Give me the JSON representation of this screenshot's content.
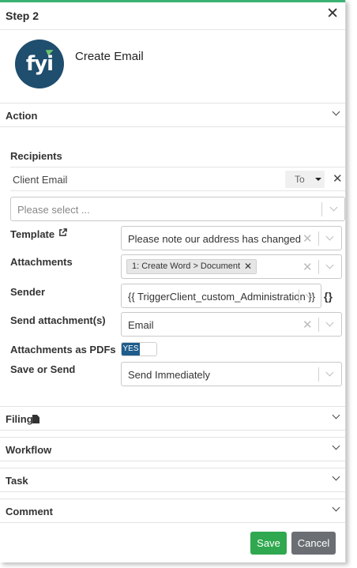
{
  "header": {
    "title": "Step 2",
    "close_icon": "close-icon"
  },
  "step": {
    "name": "Create Email",
    "logo_text": "fyi"
  },
  "sections": {
    "action": "Action",
    "filing": "Filing",
    "workflow": "Workflow",
    "task": "Task",
    "comment": "Comment"
  },
  "recipients": {
    "label": "Recipients",
    "rows": [
      {
        "name": "Client Email",
        "type": "To"
      }
    ],
    "select_placeholder": "Please select ..."
  },
  "fields": {
    "template": {
      "label": "Template",
      "value": "Please note our address has changed"
    },
    "attachments": {
      "label": "Attachments",
      "tag": "1: Create Word > Document"
    },
    "sender": {
      "label": "Sender",
      "value": "{{ TriggerClient_custom_Administration }}"
    },
    "send_attachments": {
      "label": "Send attachment(s)",
      "value": "Email"
    },
    "attachments_as_pdfs": {
      "label": "Attachments as PDFs",
      "toggle": "YES"
    },
    "save_or_send": {
      "label": "Save or Send",
      "value": "Send Immediately"
    }
  },
  "buttons": {
    "save": "Save",
    "cancel": "Cancel"
  },
  "colors": {
    "accent": "#3bb273",
    "primary": "#1e5c8b",
    "save": "#2fa84f",
    "cancel": "#6b6f74",
    "logo_bg": "#1f4e6e"
  }
}
